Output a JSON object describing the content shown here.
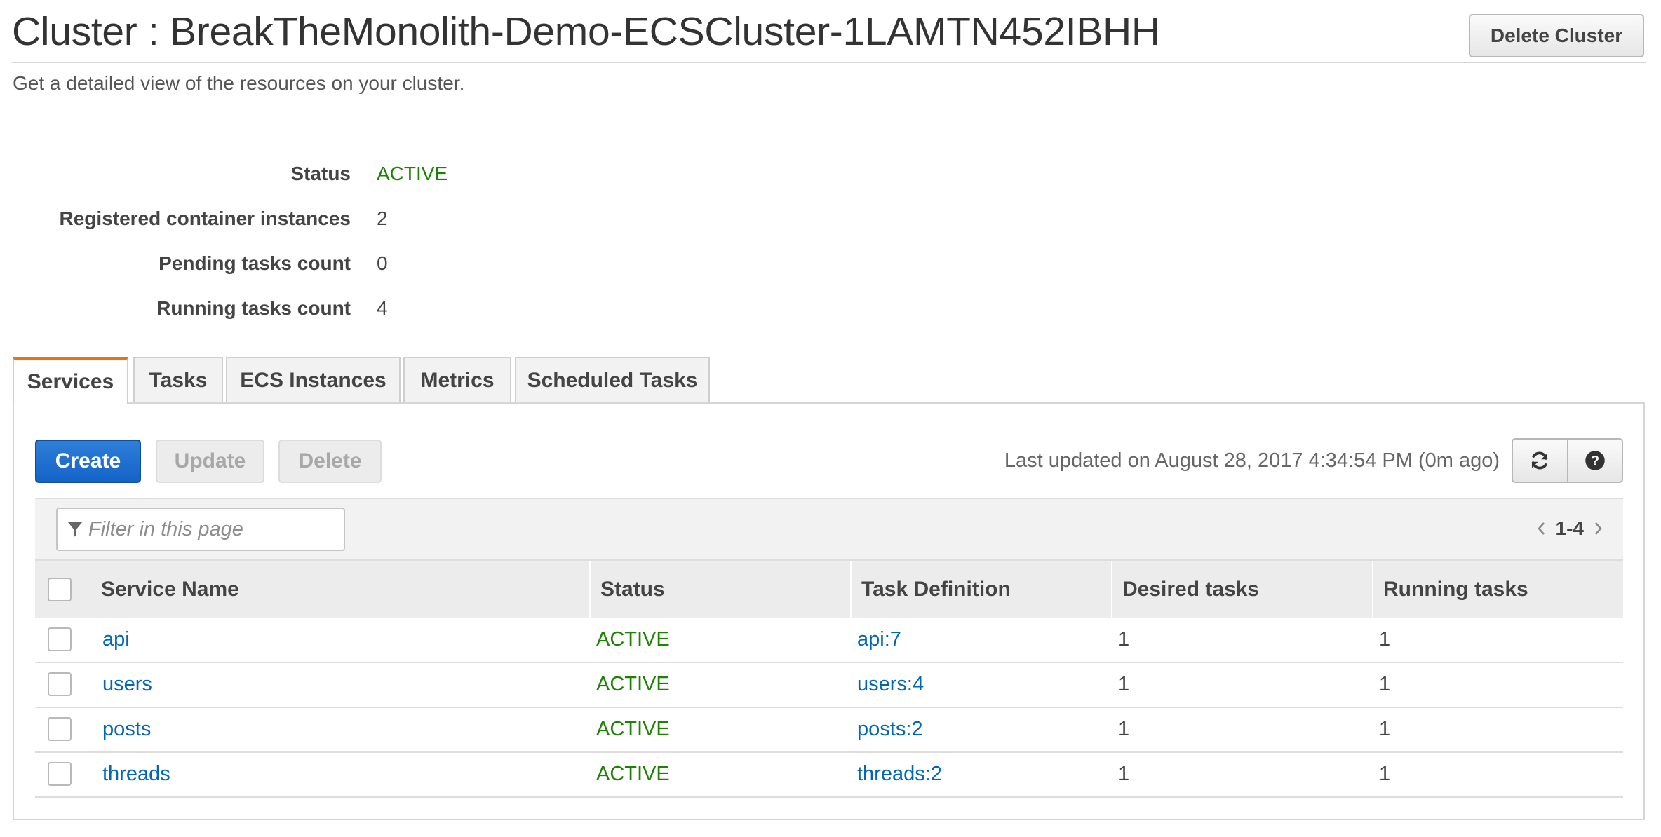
{
  "page": {
    "title": "Cluster : BreakTheMonolith-Demo-ECSCluster-1LAMTN452IBHH",
    "subtitle": "Get a detailed view of the resources on your cluster.",
    "delete_cluster_label": "Delete Cluster"
  },
  "details": [
    {
      "label": "Status",
      "value": "ACTIVE"
    },
    {
      "label": "Registered container instances",
      "value": "2"
    },
    {
      "label": "Pending tasks count",
      "value": "0"
    },
    {
      "label": "Running tasks count",
      "value": "4"
    }
  ],
  "tabs": [
    {
      "label": "Services",
      "active": true
    },
    {
      "label": "Tasks"
    },
    {
      "label": "ECS Instances"
    },
    {
      "label": "Metrics"
    },
    {
      "label": "Scheduled Tasks"
    }
  ],
  "toolbar": {
    "create_label": "Create",
    "update_label": "Update",
    "delete_label": "Delete",
    "last_updated": "Last updated on August 28, 2017 4:34:54 PM (0m ago)",
    "refresh_icon": "refresh-icon",
    "help_icon": "help-icon"
  },
  "filter": {
    "placeholder": "Filter in this page",
    "value": "",
    "icon": "filter-icon"
  },
  "pagination": {
    "range": "1-4"
  },
  "table": {
    "columns": [
      "Service Name",
      "Status",
      "Task Definition",
      "Desired tasks",
      "Running tasks"
    ],
    "rows": [
      {
        "service_name": "api",
        "status": "ACTIVE",
        "task_definition": "api:7",
        "desired": "1",
        "running": "1"
      },
      {
        "service_name": "users",
        "status": "ACTIVE",
        "task_definition": "users:4",
        "desired": "1",
        "running": "1"
      },
      {
        "service_name": "posts",
        "status": "ACTIVE",
        "task_definition": "posts:2",
        "desired": "1",
        "running": "1"
      },
      {
        "service_name": "threads",
        "status": "ACTIVE",
        "task_definition": "threads:2",
        "desired": "1",
        "running": "1"
      }
    ]
  },
  "colors": {
    "status_active": "#1d8102",
    "link": "#0066b8",
    "primary_button": "#1a6dd0",
    "active_tab_accent": "#ec7211"
  }
}
